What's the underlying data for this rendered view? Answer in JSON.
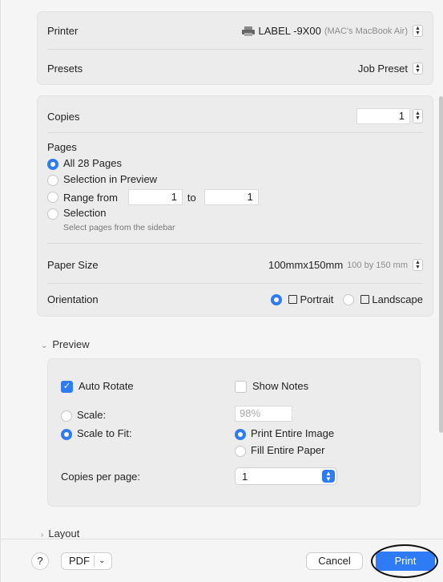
{
  "printer": {
    "label": "Printer",
    "name": "LABEL -9X00",
    "location": "(MAC's MacBook Air)"
  },
  "presets": {
    "label": "Presets",
    "value": "Job Preset"
  },
  "copies": {
    "label": "Copies",
    "value": "1"
  },
  "pages": {
    "label": "Pages",
    "options": {
      "all": "All 28 Pages",
      "selection_preview": "Selection in Preview",
      "range_from": "Range from",
      "range_to": "to",
      "selection": "Selection",
      "selection_hint": "Select pages from the sidebar"
    },
    "range_from_value": "1",
    "range_to_value": "1",
    "selected": "all"
  },
  "paper_size": {
    "label": "Paper Size",
    "value": "100mmx150mm",
    "detail": "100 by 150 mm"
  },
  "orientation": {
    "label": "Orientation",
    "portrait": "Portrait",
    "landscape": "Landscape",
    "selected": "portrait"
  },
  "preview_section": {
    "title": "Preview",
    "auto_rotate": "Auto Rotate",
    "auto_rotate_checked": true,
    "show_notes": "Show Notes",
    "show_notes_checked": false,
    "scale_label": "Scale:",
    "scale_value": "98%",
    "scale_to_fit": "Scale to Fit:",
    "print_entire_image": "Print Entire Image",
    "fill_entire_paper": "Fill Entire Paper",
    "copies_per_page_label": "Copies per page:",
    "copies_per_page_value": "1"
  },
  "layout_section": {
    "title": "Layout"
  },
  "footer": {
    "help": "?",
    "pdf": "PDF",
    "cancel": "Cancel",
    "print": "Print"
  },
  "colors": {
    "accent": "#2f7bf5"
  }
}
